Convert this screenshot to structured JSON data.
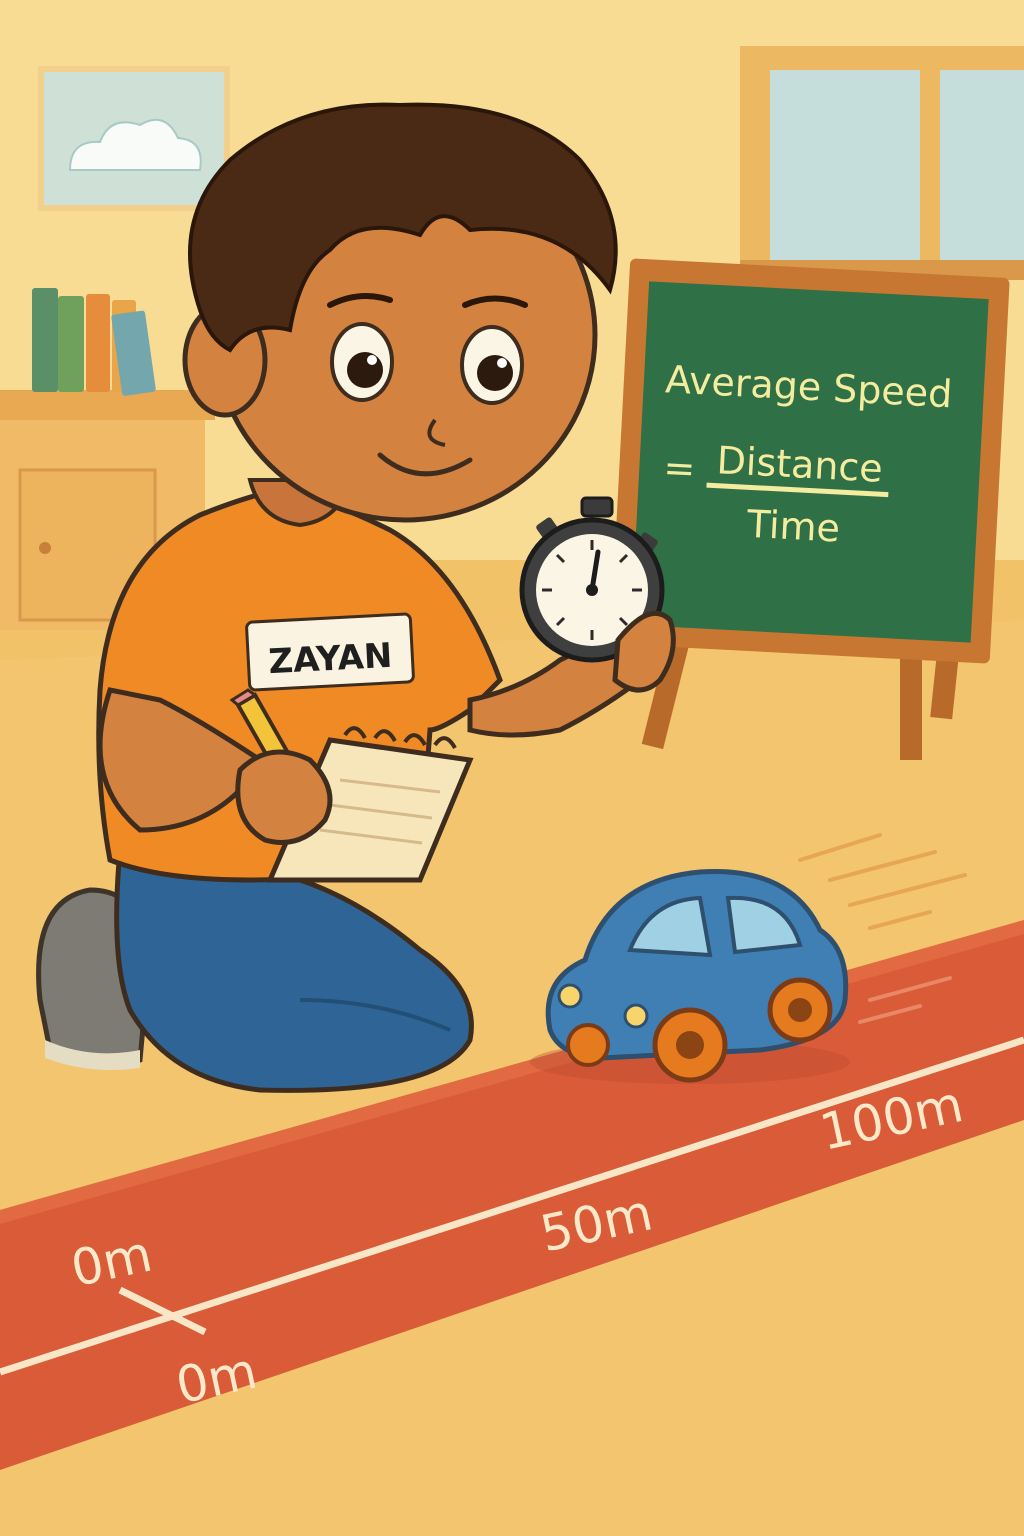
{
  "scene": {
    "subject": "boy with stopwatch and toy car on measuring track",
    "colors": {
      "wall": "#f8dc93",
      "floor": "#f2c56e",
      "board_green": "#2f7047",
      "board_frame": "#b86a2b",
      "shirt": "#f08a24",
      "jeans": "#2f6596",
      "track": "#d95b38",
      "car": "#3f7fb4",
      "wheel": "#e67a1e"
    }
  },
  "shirt_label": "ZAYAN",
  "chalkboard": {
    "line1": "Average Speed",
    "equals": "=",
    "numerator": "Distance",
    "denominator": "Time"
  },
  "track_marks": {
    "label_top_left": "0m",
    "label_bottom_left": "0m",
    "label_middle": "50m",
    "label_right": "100m"
  },
  "icons": [
    "stopwatch-icon",
    "notepad-icon",
    "pencil-icon",
    "toy-car-icon",
    "cloud-icon"
  ]
}
